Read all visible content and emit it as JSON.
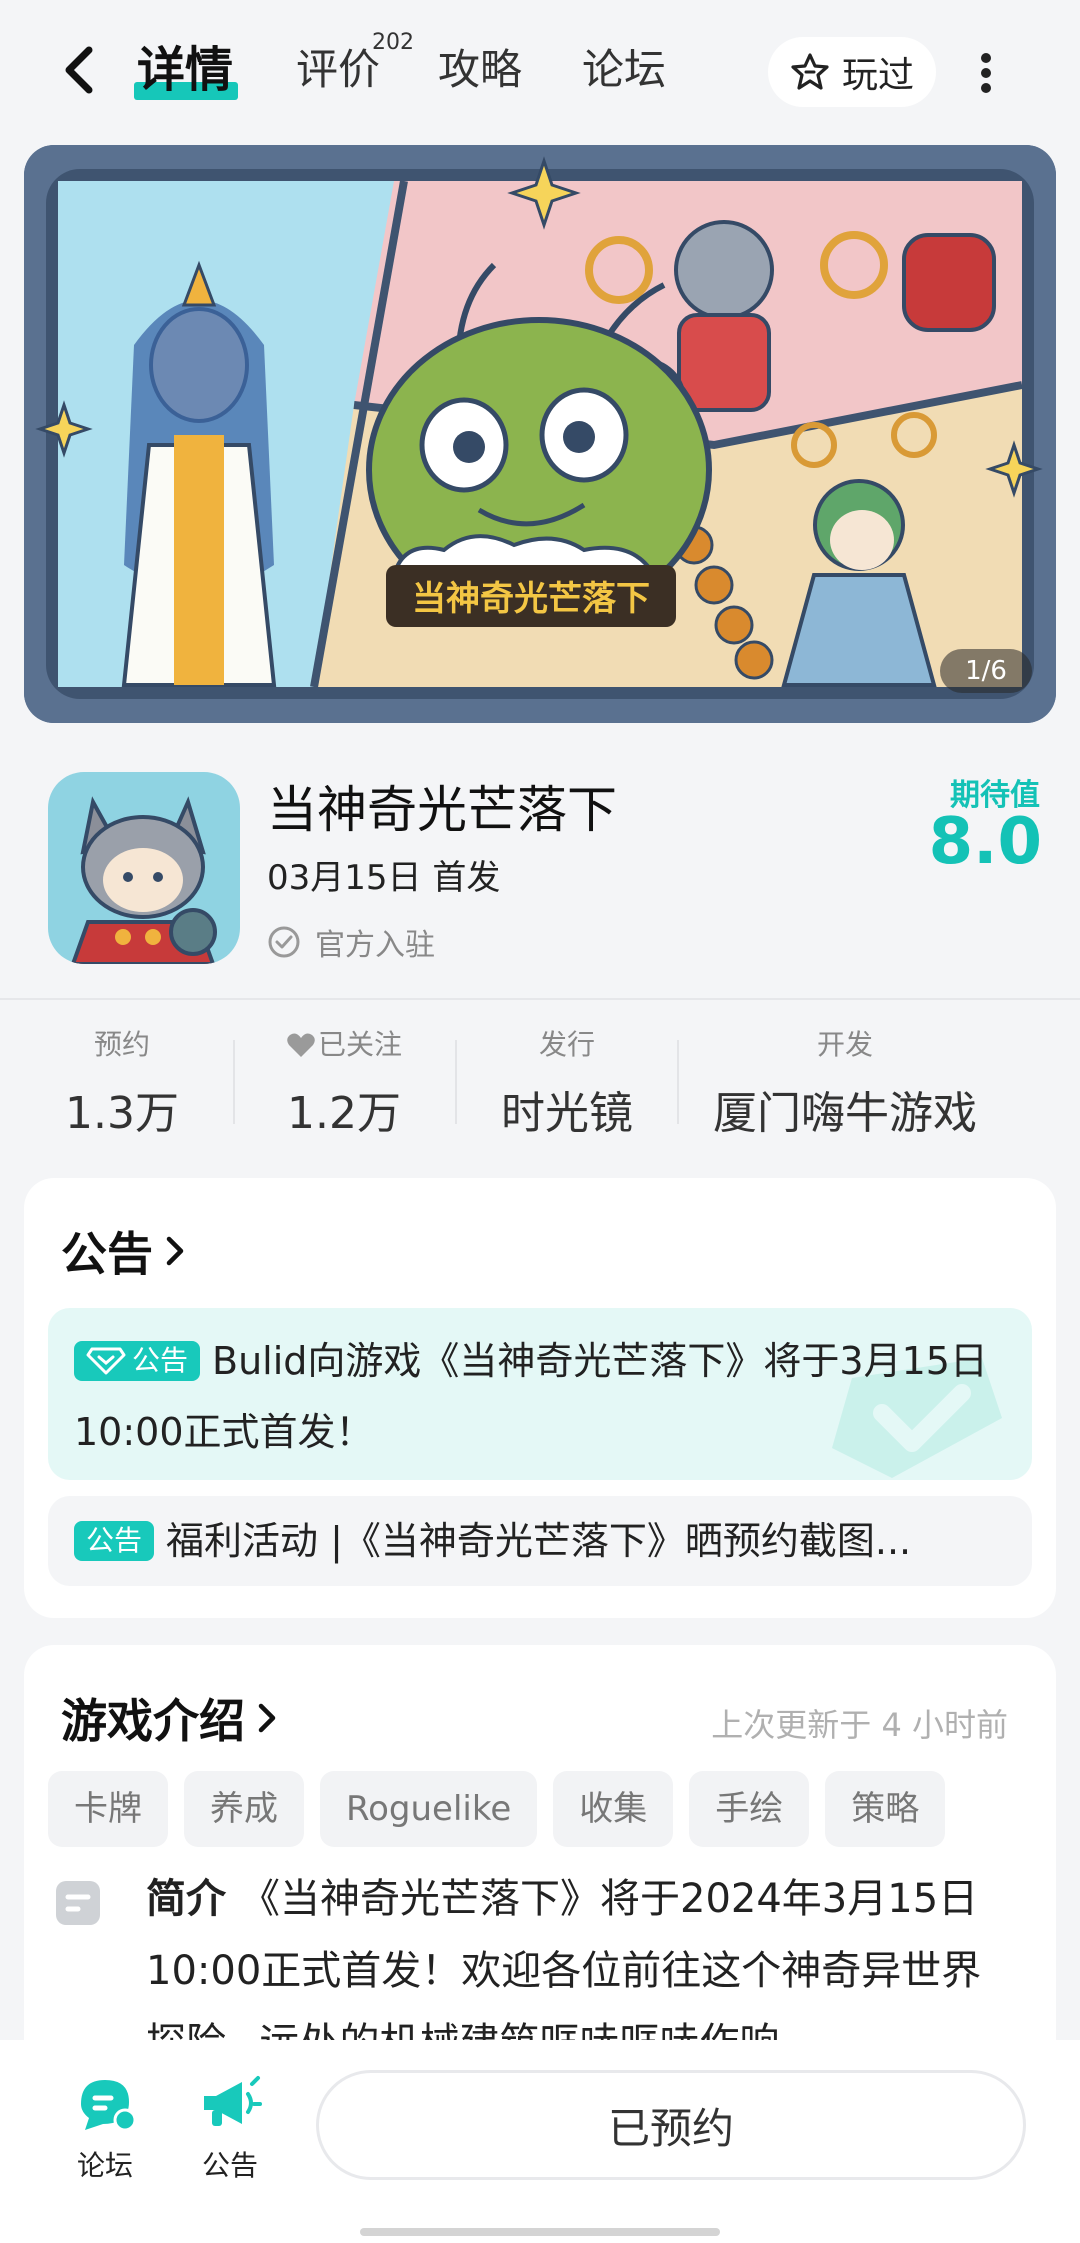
{
  "nav": {
    "tabs": [
      {
        "label": "详情",
        "active": true
      },
      {
        "label": "评价",
        "badge": "202"
      },
      {
        "label": "攻略"
      },
      {
        "label": "论坛"
      }
    ],
    "played_label": "玩过"
  },
  "banner": {
    "logo_text": "当神奇光芒落下",
    "page_indicator": "1/6"
  },
  "game": {
    "title": "当神奇光芒落下",
    "release": "03月15日 首发",
    "official": "官方入驻",
    "expect_label": "期待值",
    "expect_value": "8.0"
  },
  "stats": [
    {
      "label": "预约",
      "value": "1.3万"
    },
    {
      "label": "已关注",
      "value": "1.2万",
      "icon": "heart-icon"
    },
    {
      "label": "发行",
      "value": "时光镜"
    },
    {
      "label": "开发",
      "value": "厦门嗨牛游戏"
    }
  ],
  "announcements": {
    "title": "公告",
    "items": [
      {
        "badge": "公告",
        "text": "Bulid向游戏《当神奇光芒落下》将于3月15日10:00正式首发！"
      },
      {
        "badge": "公告",
        "text": "福利活动 |《当神奇光芒落下》晒预约截图..."
      }
    ]
  },
  "intro": {
    "title": "游戏介绍",
    "updated": "上次更新于 4 小时前",
    "tags": [
      "卡牌",
      "养成",
      "Roguelike",
      "收集",
      "手绘",
      "策略"
    ],
    "label": "简介",
    "text": "《当神奇光芒落下》将于2024年3月15日10:00正式首发！欢迎各位前往这个神奇异世界探险~远处的机械建筑哐哧哐哧作响"
  },
  "bottom": {
    "forum_label": "论坛",
    "notice_label": "公告",
    "reserve_label": "已预约"
  },
  "colors": {
    "accent": "#16c7b9",
    "background": "#f4f5f7"
  }
}
